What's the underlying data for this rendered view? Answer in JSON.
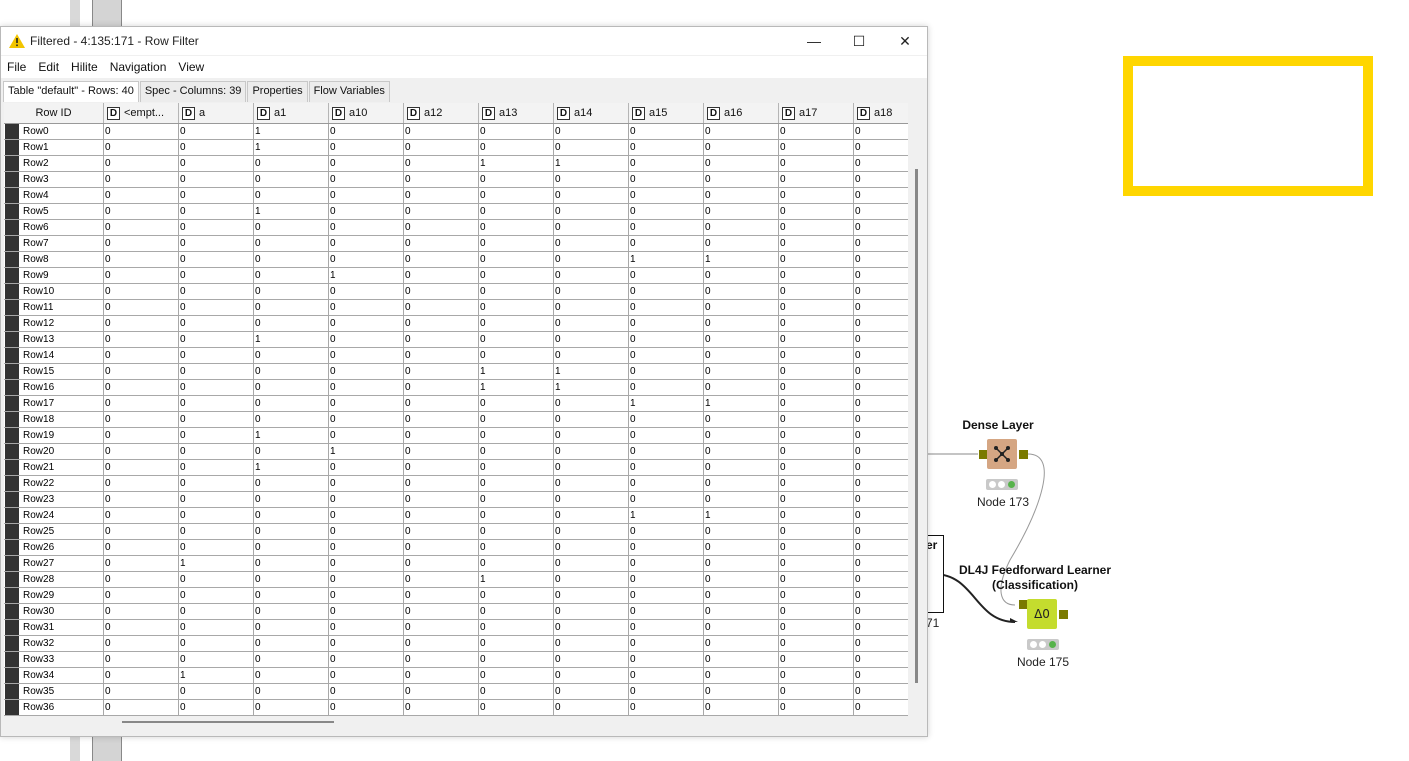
{
  "window": {
    "title": "Filtered - 4:135:171 - Row Filter",
    "controls": {
      "minimize": "—",
      "maximize": "☐",
      "close": "✕"
    }
  },
  "menu": [
    "File",
    "Edit",
    "Hilite",
    "Navigation",
    "View"
  ],
  "tabs": [
    "Table \"default\" - Rows: 40",
    "Spec - Columns: 39",
    "Properties",
    "Flow Variables"
  ],
  "table": {
    "rowid_header": "Row ID",
    "type_badge": "D",
    "columns": [
      "<empt...",
      "a",
      "a1",
      "a10",
      "a12",
      "a13",
      "a14",
      "a15",
      "a16",
      "a17",
      "a18"
    ],
    "rows": [
      {
        "id": "Row0",
        "v": [
          0,
          0,
          1,
          0,
          0,
          0,
          0,
          0,
          0,
          0,
          0
        ]
      },
      {
        "id": "Row1",
        "v": [
          0,
          0,
          1,
          0,
          0,
          0,
          0,
          0,
          0,
          0,
          0
        ]
      },
      {
        "id": "Row2",
        "v": [
          0,
          0,
          0,
          0,
          0,
          1,
          1,
          0,
          0,
          0,
          0
        ]
      },
      {
        "id": "Row3",
        "v": [
          0,
          0,
          0,
          0,
          0,
          0,
          0,
          0,
          0,
          0,
          0
        ]
      },
      {
        "id": "Row4",
        "v": [
          0,
          0,
          0,
          0,
          0,
          0,
          0,
          0,
          0,
          0,
          0
        ]
      },
      {
        "id": "Row5",
        "v": [
          0,
          0,
          1,
          0,
          0,
          0,
          0,
          0,
          0,
          0,
          0
        ]
      },
      {
        "id": "Row6",
        "v": [
          0,
          0,
          0,
          0,
          0,
          0,
          0,
          0,
          0,
          0,
          0
        ]
      },
      {
        "id": "Row7",
        "v": [
          0,
          0,
          0,
          0,
          0,
          0,
          0,
          0,
          0,
          0,
          0
        ]
      },
      {
        "id": "Row8",
        "v": [
          0,
          0,
          0,
          0,
          0,
          0,
          0,
          1,
          1,
          0,
          0
        ]
      },
      {
        "id": "Row9",
        "v": [
          0,
          0,
          0,
          1,
          0,
          0,
          0,
          0,
          0,
          0,
          0
        ]
      },
      {
        "id": "Row10",
        "v": [
          0,
          0,
          0,
          0,
          0,
          0,
          0,
          0,
          0,
          0,
          0
        ]
      },
      {
        "id": "Row11",
        "v": [
          0,
          0,
          0,
          0,
          0,
          0,
          0,
          0,
          0,
          0,
          0
        ]
      },
      {
        "id": "Row12",
        "v": [
          0,
          0,
          0,
          0,
          0,
          0,
          0,
          0,
          0,
          0,
          0
        ]
      },
      {
        "id": "Row13",
        "v": [
          0,
          0,
          1,
          0,
          0,
          0,
          0,
          0,
          0,
          0,
          0
        ]
      },
      {
        "id": "Row14",
        "v": [
          0,
          0,
          0,
          0,
          0,
          0,
          0,
          0,
          0,
          0,
          0
        ]
      },
      {
        "id": "Row15",
        "v": [
          0,
          0,
          0,
          0,
          0,
          1,
          1,
          0,
          0,
          0,
          0
        ]
      },
      {
        "id": "Row16",
        "v": [
          0,
          0,
          0,
          0,
          0,
          1,
          1,
          0,
          0,
          0,
          0
        ]
      },
      {
        "id": "Row17",
        "v": [
          0,
          0,
          0,
          0,
          0,
          0,
          0,
          1,
          1,
          0,
          0
        ]
      },
      {
        "id": "Row18",
        "v": [
          0,
          0,
          0,
          0,
          0,
          0,
          0,
          0,
          0,
          0,
          0
        ]
      },
      {
        "id": "Row19",
        "v": [
          0,
          0,
          1,
          0,
          0,
          0,
          0,
          0,
          0,
          0,
          0
        ]
      },
      {
        "id": "Row20",
        "v": [
          0,
          0,
          0,
          1,
          0,
          0,
          0,
          0,
          0,
          0,
          0
        ]
      },
      {
        "id": "Row21",
        "v": [
          0,
          0,
          1,
          0,
          0,
          0,
          0,
          0,
          0,
          0,
          0
        ]
      },
      {
        "id": "Row22",
        "v": [
          0,
          0,
          0,
          0,
          0,
          0,
          0,
          0,
          0,
          0,
          0
        ]
      },
      {
        "id": "Row23",
        "v": [
          0,
          0,
          0,
          0,
          0,
          0,
          0,
          0,
          0,
          0,
          0
        ]
      },
      {
        "id": "Row24",
        "v": [
          0,
          0,
          0,
          0,
          0,
          0,
          0,
          1,
          1,
          0,
          0
        ]
      },
      {
        "id": "Row25",
        "v": [
          0,
          0,
          0,
          0,
          0,
          0,
          0,
          0,
          0,
          0,
          0
        ]
      },
      {
        "id": "Row26",
        "v": [
          0,
          0,
          0,
          0,
          0,
          0,
          0,
          0,
          0,
          0,
          0
        ]
      },
      {
        "id": "Row27",
        "v": [
          0,
          1,
          0,
          0,
          0,
          0,
          0,
          0,
          0,
          0,
          0
        ]
      },
      {
        "id": "Row28",
        "v": [
          0,
          0,
          0,
          0,
          0,
          1,
          0,
          0,
          0,
          0,
          0
        ]
      },
      {
        "id": "Row29",
        "v": [
          0,
          0,
          0,
          0,
          0,
          0,
          0,
          0,
          0,
          0,
          0
        ]
      },
      {
        "id": "Row30",
        "v": [
          0,
          0,
          0,
          0,
          0,
          0,
          0,
          0,
          0,
          0,
          0
        ]
      },
      {
        "id": "Row31",
        "v": [
          0,
          0,
          0,
          0,
          0,
          0,
          0,
          0,
          0,
          0,
          0
        ]
      },
      {
        "id": "Row32",
        "v": [
          0,
          0,
          0,
          0,
          0,
          0,
          0,
          0,
          0,
          0,
          0
        ]
      },
      {
        "id": "Row33",
        "v": [
          0,
          0,
          0,
          0,
          0,
          0,
          0,
          0,
          0,
          0,
          0
        ]
      },
      {
        "id": "Row34",
        "v": [
          0,
          1,
          0,
          0,
          0,
          0,
          0,
          0,
          0,
          0,
          0
        ]
      },
      {
        "id": "Row35",
        "v": [
          0,
          0,
          0,
          0,
          0,
          0,
          0,
          0,
          0,
          0,
          0
        ]
      },
      {
        "id": "Row36",
        "v": [
          0,
          0,
          0,
          0,
          0,
          0,
          0,
          0,
          0,
          0,
          0
        ]
      }
    ]
  },
  "workflow": {
    "dense_layer": {
      "title": "Dense Layer",
      "label": "Node 173",
      "color": "#d5a683"
    },
    "learner": {
      "title_line1": "DL4J Feedforward Learner",
      "title_line2": "(Classification)",
      "label": "Node 175",
      "color": "#c4dc2e"
    },
    "hidden_node": {
      "title_fragment": "er",
      "label_fragment": "71"
    },
    "annotation_color": "#ffd600"
  }
}
